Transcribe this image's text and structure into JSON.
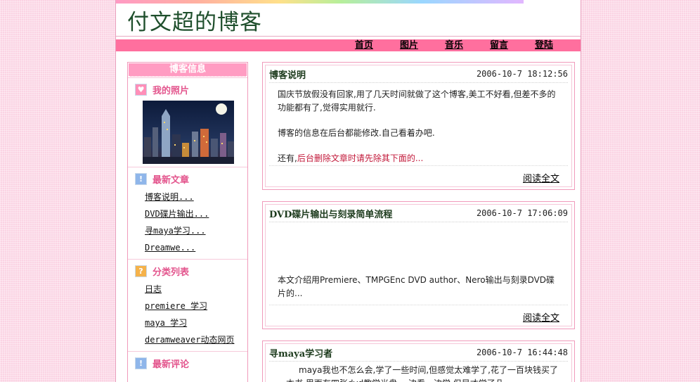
{
  "site": {
    "title": "付文超的博客"
  },
  "nav": [
    "首页",
    "图片",
    "音乐",
    "留言",
    "登陆"
  ],
  "sidebar": {
    "header": "博客信息",
    "photo": {
      "title": "我的照片",
      "icon": "heart-icon"
    },
    "recent": {
      "title": "最新文章",
      "icon": "exclamation-icon",
      "items": [
        "博客说明...",
        "DVD碟片输出...",
        "寻maya学习...",
        "Dreamwe..."
      ]
    },
    "categories": {
      "title": "分类列表",
      "icon": "question-icon",
      "items": [
        "日志",
        "premiere 学习",
        "maya 学习",
        "deramweaver动态网页"
      ]
    },
    "comments": {
      "title": "最新评论",
      "icon": "exclamation-icon"
    }
  },
  "posts": [
    {
      "title": "博客说明",
      "date": "2006-10-7 18:12:56",
      "p1": "国庆节放假没有回家,用了几天时间就做了这个博客,美工不好看,但差不多的功能都有了,觉得实用就行.",
      "p2": "博客的信息在后台都能修改.自己看着办吧.",
      "p3_prefix": "还有,",
      "p3_red": "后台删除文章时请先除其下面的...",
      "read_more": "阅读全文"
    },
    {
      "title": "DVD碟片输出与刻录简单流程",
      "date": "2006-10-7 17:06:09",
      "p1": "本文介绍用Premiere、TMPGEnc DVD author、Nero输出与刻录DVD碟片的...",
      "read_more": "阅读全文"
    },
    {
      "title": "寻maya学习者",
      "date": "2006-10-7 16:44:48",
      "p1": "maya我也不怎么会,学了一些时间,但感觉太难学了,花了一百块钱买了一本书,里面有四张dvd教学光盘,一边看一边学,但是才学了几"
    }
  ],
  "colors": {
    "accent": "#ff6f9e",
    "sidebar_title": "#e3558d",
    "highlight_red": "#c2193a"
  }
}
